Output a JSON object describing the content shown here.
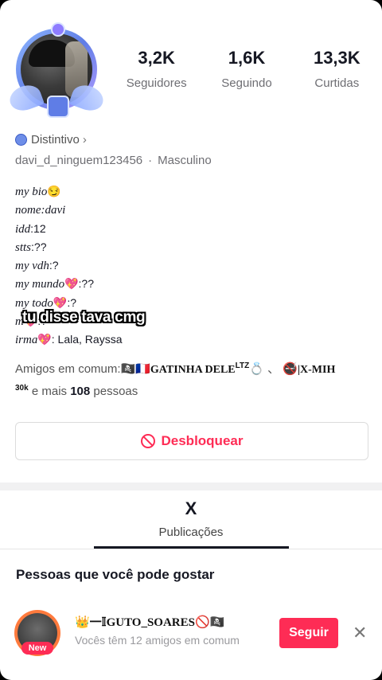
{
  "stats": [
    {
      "value": "3,2K",
      "label": "Seguidores"
    },
    {
      "value": "1,6K",
      "label": "Seguindo"
    },
    {
      "value": "13,3K",
      "label": "Curtidas"
    }
  ],
  "badge": {
    "label": "Distintivo",
    "chevron": "›"
  },
  "profile": {
    "username": "davi_d_ninguem123456",
    "separator": "·",
    "gender": "Masculino"
  },
  "bio": {
    "lines": [
      {
        "key": "my bio",
        "suffix": "😏",
        "value": ""
      },
      {
        "key": "nome",
        "value": ":davi"
      },
      {
        "key": "idd",
        "value": ":12"
      },
      {
        "key": "stts",
        "value": ":??"
      },
      {
        "key": "my vdh",
        "value": ":?"
      },
      {
        "key": "my mundo",
        "emoji": "💖",
        "value": ":??"
      },
      {
        "key": "my todo",
        "emoji": "💖",
        "value": ":?"
      },
      {
        "key": "m",
        "emoji": "💖",
        "value": ":?"
      },
      {
        "key": "irma",
        "emoji": "💖",
        "value": ": Lala, Rayssa"
      }
    ]
  },
  "caption": "tu disse tava cmg",
  "friends": {
    "prefix": "Amigos em comum:",
    "friend1_icons": "🏴‍☠️🇫🇷",
    "friend1_name": "GATINHA DELE",
    "friend1_sup": "LTZ",
    "friend1_suffix": "💍 、",
    "friend2_icon": "🚭",
    "friend2_name": "|X-MIH",
    "friend2_sup": "30k",
    "more_text": " e mais ",
    "more_count": "108",
    "more_suffix": " pessoas"
  },
  "actions": {
    "unblock_label": "Desbloquear"
  },
  "tabs": {
    "posts_icon": "X",
    "posts_label": "Publicações"
  },
  "suggestions": {
    "title": "Pessoas que você pode gostar",
    "items": [
      {
        "name": "👑一𝕀GUTO_SOARES🚫🏴‍☠️",
        "subtitle": "Vocês têm 12 amigos em comum",
        "badge": "New",
        "follow_label": "Seguir",
        "close_icon": "✕"
      }
    ]
  },
  "colors": {
    "accent": "#fe2c55",
    "text": "#161823"
  }
}
